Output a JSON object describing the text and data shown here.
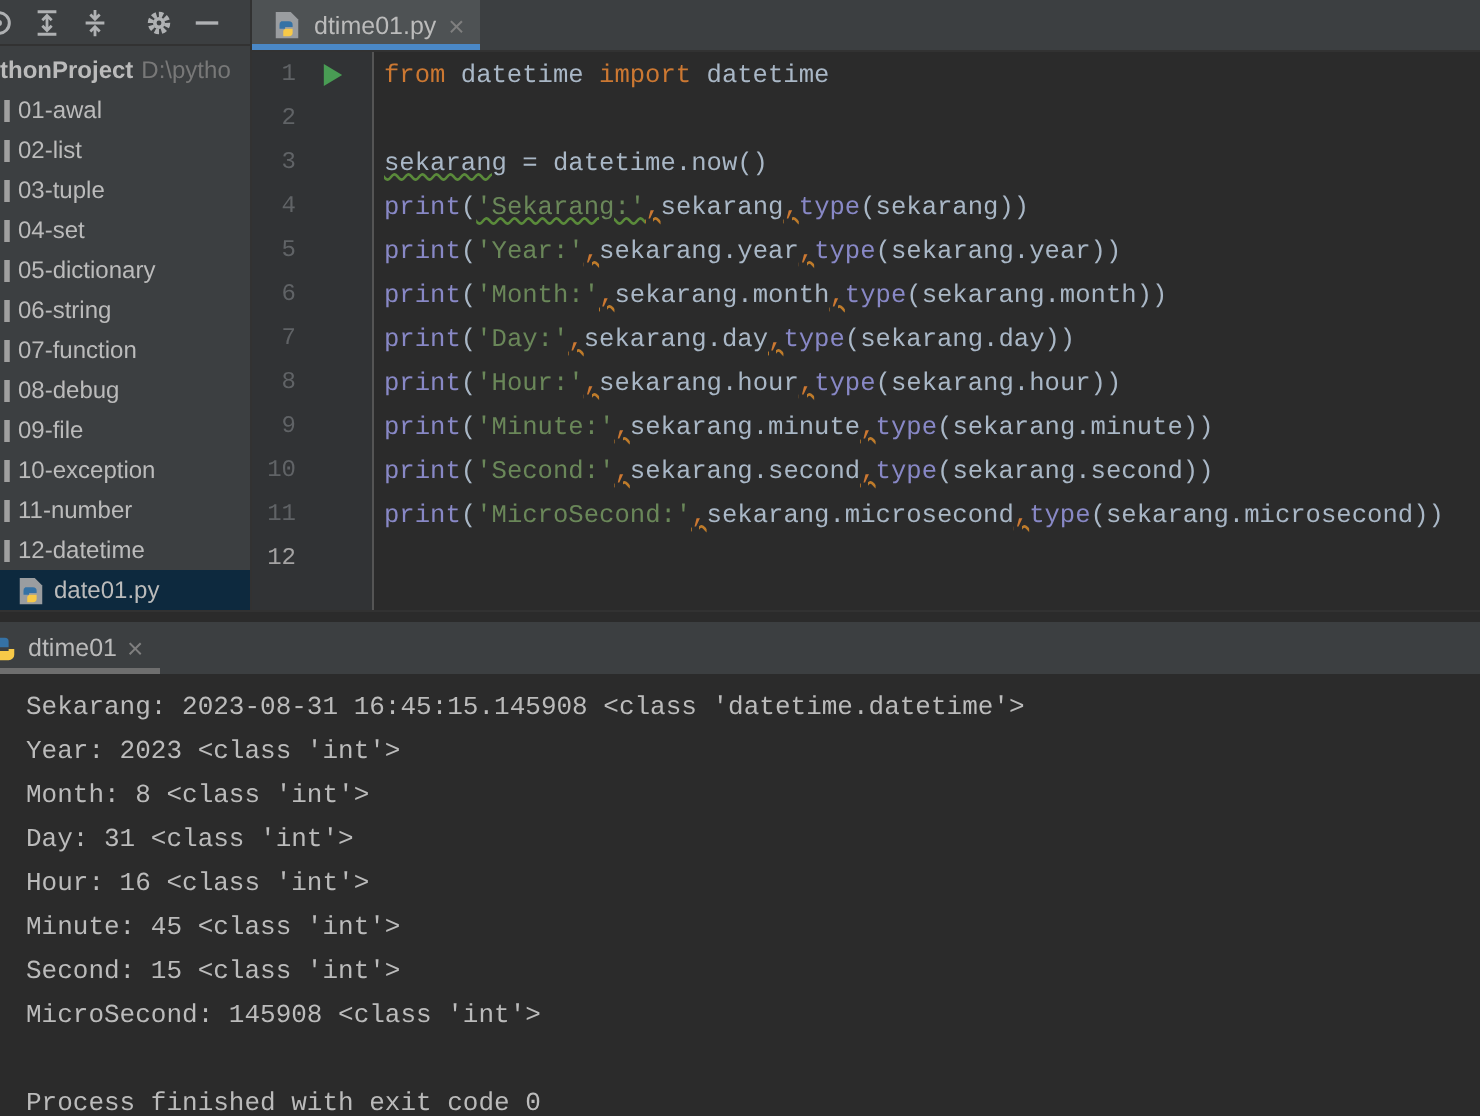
{
  "editor_tabs": [
    {
      "label": "dtime01.py",
      "close": "×",
      "selected": true
    }
  ],
  "project": {
    "name": "thonProject",
    "path": "D:\\pytho",
    "items": [
      {
        "label": "01-awal",
        "selected": false
      },
      {
        "label": "02-list",
        "selected": false
      },
      {
        "label": "03-tuple",
        "selected": false
      },
      {
        "label": "04-set",
        "selected": false
      },
      {
        "label": "05-dictionary",
        "selected": false
      },
      {
        "label": "06-string",
        "selected": false
      },
      {
        "label": "07-function",
        "selected": false
      },
      {
        "label": "08-debug",
        "selected": false
      },
      {
        "label": "09-file",
        "selected": false
      },
      {
        "label": "10-exception",
        "selected": false
      },
      {
        "label": "11-number",
        "selected": false
      },
      {
        "label": "12-datetime",
        "selected": false,
        "children": [
          {
            "label": "date01.py",
            "selected": true
          }
        ]
      }
    ]
  },
  "code": [
    {
      "number": "1",
      "run": true,
      "current": false,
      "tokens": [
        {
          "t": "from",
          "kind": "keyword",
          "typo": false
        },
        {
          "t": " datetime ",
          "kind": "plain",
          "typo": false
        },
        {
          "t": "import",
          "kind": "keyword",
          "typo": false
        },
        {
          "t": " datetime",
          "kind": "plain",
          "typo": false
        }
      ]
    },
    {
      "number": "2",
      "run": false,
      "current": false
    },
    {
      "number": "3",
      "run": false,
      "current": false,
      "tokens": [
        {
          "t": "sekarang",
          "kind": "plain",
          "typo": true
        },
        {
          "t": " = datetime.now()",
          "kind": "plain",
          "typo": false
        }
      ]
    },
    {
      "number": "4",
      "run": false,
      "current": false,
      "tokens": [
        {
          "t": "print",
          "kind": "builtin",
          "typo": false
        },
        {
          "t": "(",
          "kind": "plain",
          "typo": false
        },
        {
          "t": "'Sekarang:'",
          "kind": "string",
          "typo": true
        },
        {
          "t": ",",
          "kind": "comma",
          "typo": false
        },
        {
          "t": "sekarang",
          "kind": "plain",
          "typo": false
        },
        {
          "t": ",",
          "kind": "comma",
          "typo": false
        },
        {
          "t": "type",
          "kind": "builtin",
          "typo": false
        },
        {
          "t": "(sekarang))",
          "kind": "plain",
          "typo": false
        }
      ]
    },
    {
      "number": "5",
      "run": false,
      "current": false,
      "tokens": [
        {
          "t": "print",
          "kind": "builtin",
          "typo": false
        },
        {
          "t": "(",
          "kind": "plain",
          "typo": false
        },
        {
          "t": "'Year:'",
          "kind": "string",
          "typo": false
        },
        {
          "t": ",",
          "kind": "comma",
          "typo": false
        },
        {
          "t": "sekarang.year",
          "kind": "plain",
          "typo": false
        },
        {
          "t": ",",
          "kind": "comma",
          "typo": false
        },
        {
          "t": "type",
          "kind": "builtin",
          "typo": false
        },
        {
          "t": "(sekarang.year))",
          "kind": "plain",
          "typo": false
        }
      ]
    },
    {
      "number": "6",
      "run": false,
      "current": false,
      "tokens": [
        {
          "t": "print",
          "kind": "builtin",
          "typo": false
        },
        {
          "t": "(",
          "kind": "plain",
          "typo": false
        },
        {
          "t": "'Month:'",
          "kind": "string",
          "typo": false
        },
        {
          "t": ",",
          "kind": "comma",
          "typo": false
        },
        {
          "t": "sekarang.month",
          "kind": "plain",
          "typo": false
        },
        {
          "t": ",",
          "kind": "comma",
          "typo": false
        },
        {
          "t": "type",
          "kind": "builtin",
          "typo": false
        },
        {
          "t": "(sekarang.month))",
          "kind": "plain",
          "typo": false
        }
      ]
    },
    {
      "number": "7",
      "run": false,
      "current": false,
      "tokens": [
        {
          "t": "print",
          "kind": "builtin",
          "typo": false
        },
        {
          "t": "(",
          "kind": "plain",
          "typo": false
        },
        {
          "t": "'Day:'",
          "kind": "string",
          "typo": false
        },
        {
          "t": ",",
          "kind": "comma",
          "typo": false
        },
        {
          "t": "sekarang.day",
          "kind": "plain",
          "typo": false
        },
        {
          "t": ",",
          "kind": "comma",
          "typo": false
        },
        {
          "t": "type",
          "kind": "builtin",
          "typo": false
        },
        {
          "t": "(sekarang.day))",
          "kind": "plain",
          "typo": false
        }
      ]
    },
    {
      "number": "8",
      "run": false,
      "current": false,
      "tokens": [
        {
          "t": "print",
          "kind": "builtin",
          "typo": false
        },
        {
          "t": "(",
          "kind": "plain",
          "typo": false
        },
        {
          "t": "'Hour:'",
          "kind": "string",
          "typo": false
        },
        {
          "t": ",",
          "kind": "comma",
          "typo": false
        },
        {
          "t": "sekarang.hour",
          "kind": "plain",
          "typo": false
        },
        {
          "t": ",",
          "kind": "comma",
          "typo": false
        },
        {
          "t": "type",
          "kind": "builtin",
          "typo": false
        },
        {
          "t": "(sekarang.hour))",
          "kind": "plain",
          "typo": false
        }
      ]
    },
    {
      "number": "9",
      "run": false,
      "current": false,
      "tokens": [
        {
          "t": "print",
          "kind": "builtin",
          "typo": false
        },
        {
          "t": "(",
          "kind": "plain",
          "typo": false
        },
        {
          "t": "'Minute:'",
          "kind": "string",
          "typo": false
        },
        {
          "t": ",",
          "kind": "comma",
          "typo": false
        },
        {
          "t": "sekarang.minute",
          "kind": "plain",
          "typo": false
        },
        {
          "t": ",",
          "kind": "comma",
          "typo": false
        },
        {
          "t": "type",
          "kind": "builtin",
          "typo": false
        },
        {
          "t": "(sekarang.minute))",
          "kind": "plain",
          "typo": false
        }
      ]
    },
    {
      "number": "10",
      "run": false,
      "current": false,
      "tokens": [
        {
          "t": "print",
          "kind": "builtin",
          "typo": false
        },
        {
          "t": "(",
          "kind": "plain",
          "typo": false
        },
        {
          "t": "'Second:'",
          "kind": "string",
          "typo": false
        },
        {
          "t": ",",
          "kind": "comma",
          "typo": false
        },
        {
          "t": "sekarang.second",
          "kind": "plain",
          "typo": false
        },
        {
          "t": ",",
          "kind": "comma",
          "typo": false
        },
        {
          "t": "type",
          "kind": "builtin",
          "typo": false
        },
        {
          "t": "(sekarang.second))",
          "kind": "plain",
          "typo": false
        }
      ]
    },
    {
      "number": "11",
      "run": false,
      "current": false,
      "tokens": [
        {
          "t": "print",
          "kind": "builtin",
          "typo": false
        },
        {
          "t": "(",
          "kind": "plain",
          "typo": false
        },
        {
          "t": "'MicroSecond:'",
          "kind": "string",
          "typo": false
        },
        {
          "t": ",",
          "kind": "comma",
          "typo": false
        },
        {
          "t": "sekarang.microsecond",
          "kind": "plain",
          "typo": false
        },
        {
          "t": ",",
          "kind": "comma",
          "typo": false
        },
        {
          "t": "type",
          "kind": "builtin",
          "typo": false
        },
        {
          "t": "(sekarang.microsecond))",
          "kind": "plain",
          "typo": false
        }
      ]
    },
    {
      "number": "12",
      "run": false,
      "current": true
    }
  ],
  "run_tabs": [
    {
      "label": "dtime01",
      "close": "×",
      "selected": true
    }
  ],
  "output": [
    "Sekarang: 2023-08-31 16:45:15.145908 <class 'datetime.datetime'>",
    "Year: 2023 <class 'int'>",
    "Month: 8 <class 'int'>",
    "Day: 31 <class 'int'>",
    "Hour: 16 <class 'int'>",
    "Minute: 45 <class 'int'>",
    "Second: 15 <class 'int'>",
    "MicroSecond: 145908 <class 'int'>"
  ],
  "exit_message": "Process finished with exit code 0"
}
